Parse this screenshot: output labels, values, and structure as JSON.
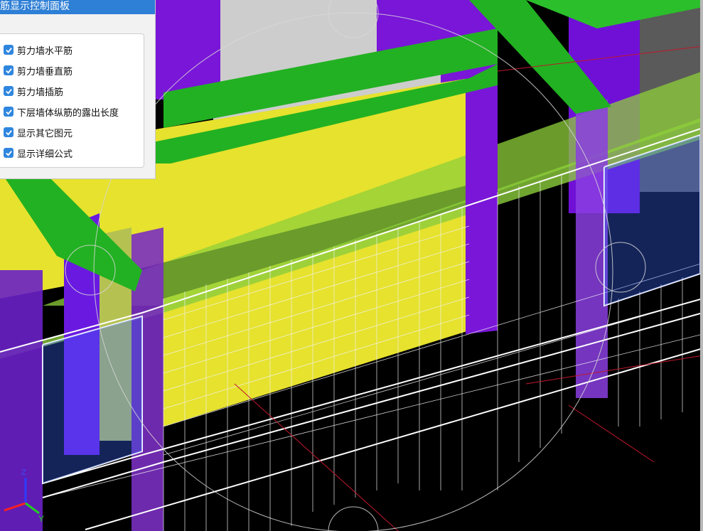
{
  "panel": {
    "title": "钢筋显示控制面板",
    "options": [
      {
        "label": "剪力墙水平筋",
        "checked": true
      },
      {
        "label": "剪力墙垂直筋",
        "checked": true
      },
      {
        "label": "剪力墙插筋",
        "checked": true
      },
      {
        "label": "下层墙体纵筋的露出长度",
        "checked": true
      },
      {
        "label": "显示其它图元",
        "checked": true
      },
      {
        "label": "显示详细公式",
        "checked": true
      }
    ]
  },
  "axis_triad": {
    "y_label": "Y",
    "z_label": "Z"
  },
  "colors": {
    "panel_header": "#2e7fd6",
    "checkbox": "#2f86de",
    "wall_yellow": "#e6e22e",
    "beam_green": "#22b122",
    "column_purple": "#7a16d8",
    "slab_gray": "#cfcfcf"
  }
}
